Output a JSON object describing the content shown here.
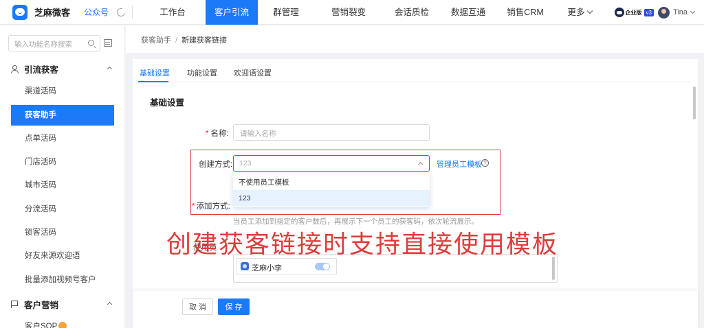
{
  "app": {
    "name": "芝麻微客",
    "account_label": "公众号"
  },
  "nav": {
    "items": [
      {
        "label": "工作台"
      },
      {
        "label": "客户引流",
        "active": true
      },
      {
        "label": "群管理"
      },
      {
        "label": "营销裂变"
      },
      {
        "label": "会话质检"
      },
      {
        "label": "数据互通"
      },
      {
        "label": "销售CRM"
      },
      {
        "label": "更多"
      }
    ]
  },
  "user": {
    "edition": "企业版",
    "version": "v3",
    "name": "Tina"
  },
  "sidebar": {
    "search_placeholder": "输入功能名称搜索",
    "groups": [
      {
        "label": "引流获客",
        "icon": "user-icon"
      },
      {
        "label": "客户营销",
        "icon": "flag-icon"
      }
    ],
    "items": [
      {
        "label": "渠道活码"
      },
      {
        "label": "获客助手",
        "active": true
      },
      {
        "label": "点单活码"
      },
      {
        "label": "门店活码"
      },
      {
        "label": "城市活码"
      },
      {
        "label": "分流活码"
      },
      {
        "label": "锁客活码"
      },
      {
        "label": "好友来源欢迎语"
      },
      {
        "label": "批量添加视频号客户"
      },
      {
        "label": "客户SOP"
      }
    ]
  },
  "breadcrumb": {
    "parent": "获客助手",
    "separator": "/",
    "current": "新建获客链接"
  },
  "tabs": [
    {
      "label": "基础设置",
      "active": true
    },
    {
      "label": "功能设置"
    },
    {
      "label": "欢迎语设置"
    }
  ],
  "form": {
    "section_title": "基础设置",
    "name_label": "名称:",
    "name_placeholder": "请输入名称",
    "create_label": "创建方式:",
    "create_value": "123",
    "manage_link": "管理员工模板",
    "dropdown_options": [
      "不使用员工模板",
      "123"
    ],
    "dropdown_selected": "123",
    "add_label": "添加方式:",
    "add_hint": "当员工添加到指定的客户数后，再展示下一个员工的获客码，依次轮流展示。",
    "employee_chip": "芝麻小李",
    "employee_toggle_on": true
  },
  "annotation": "创建获客链接时支持直接使用模板",
  "footer": {
    "cancel_label": "取 消",
    "save_label": "保 存"
  },
  "colors": {
    "accent": "#1a7af8",
    "annotation_red": "#e03b3b"
  }
}
